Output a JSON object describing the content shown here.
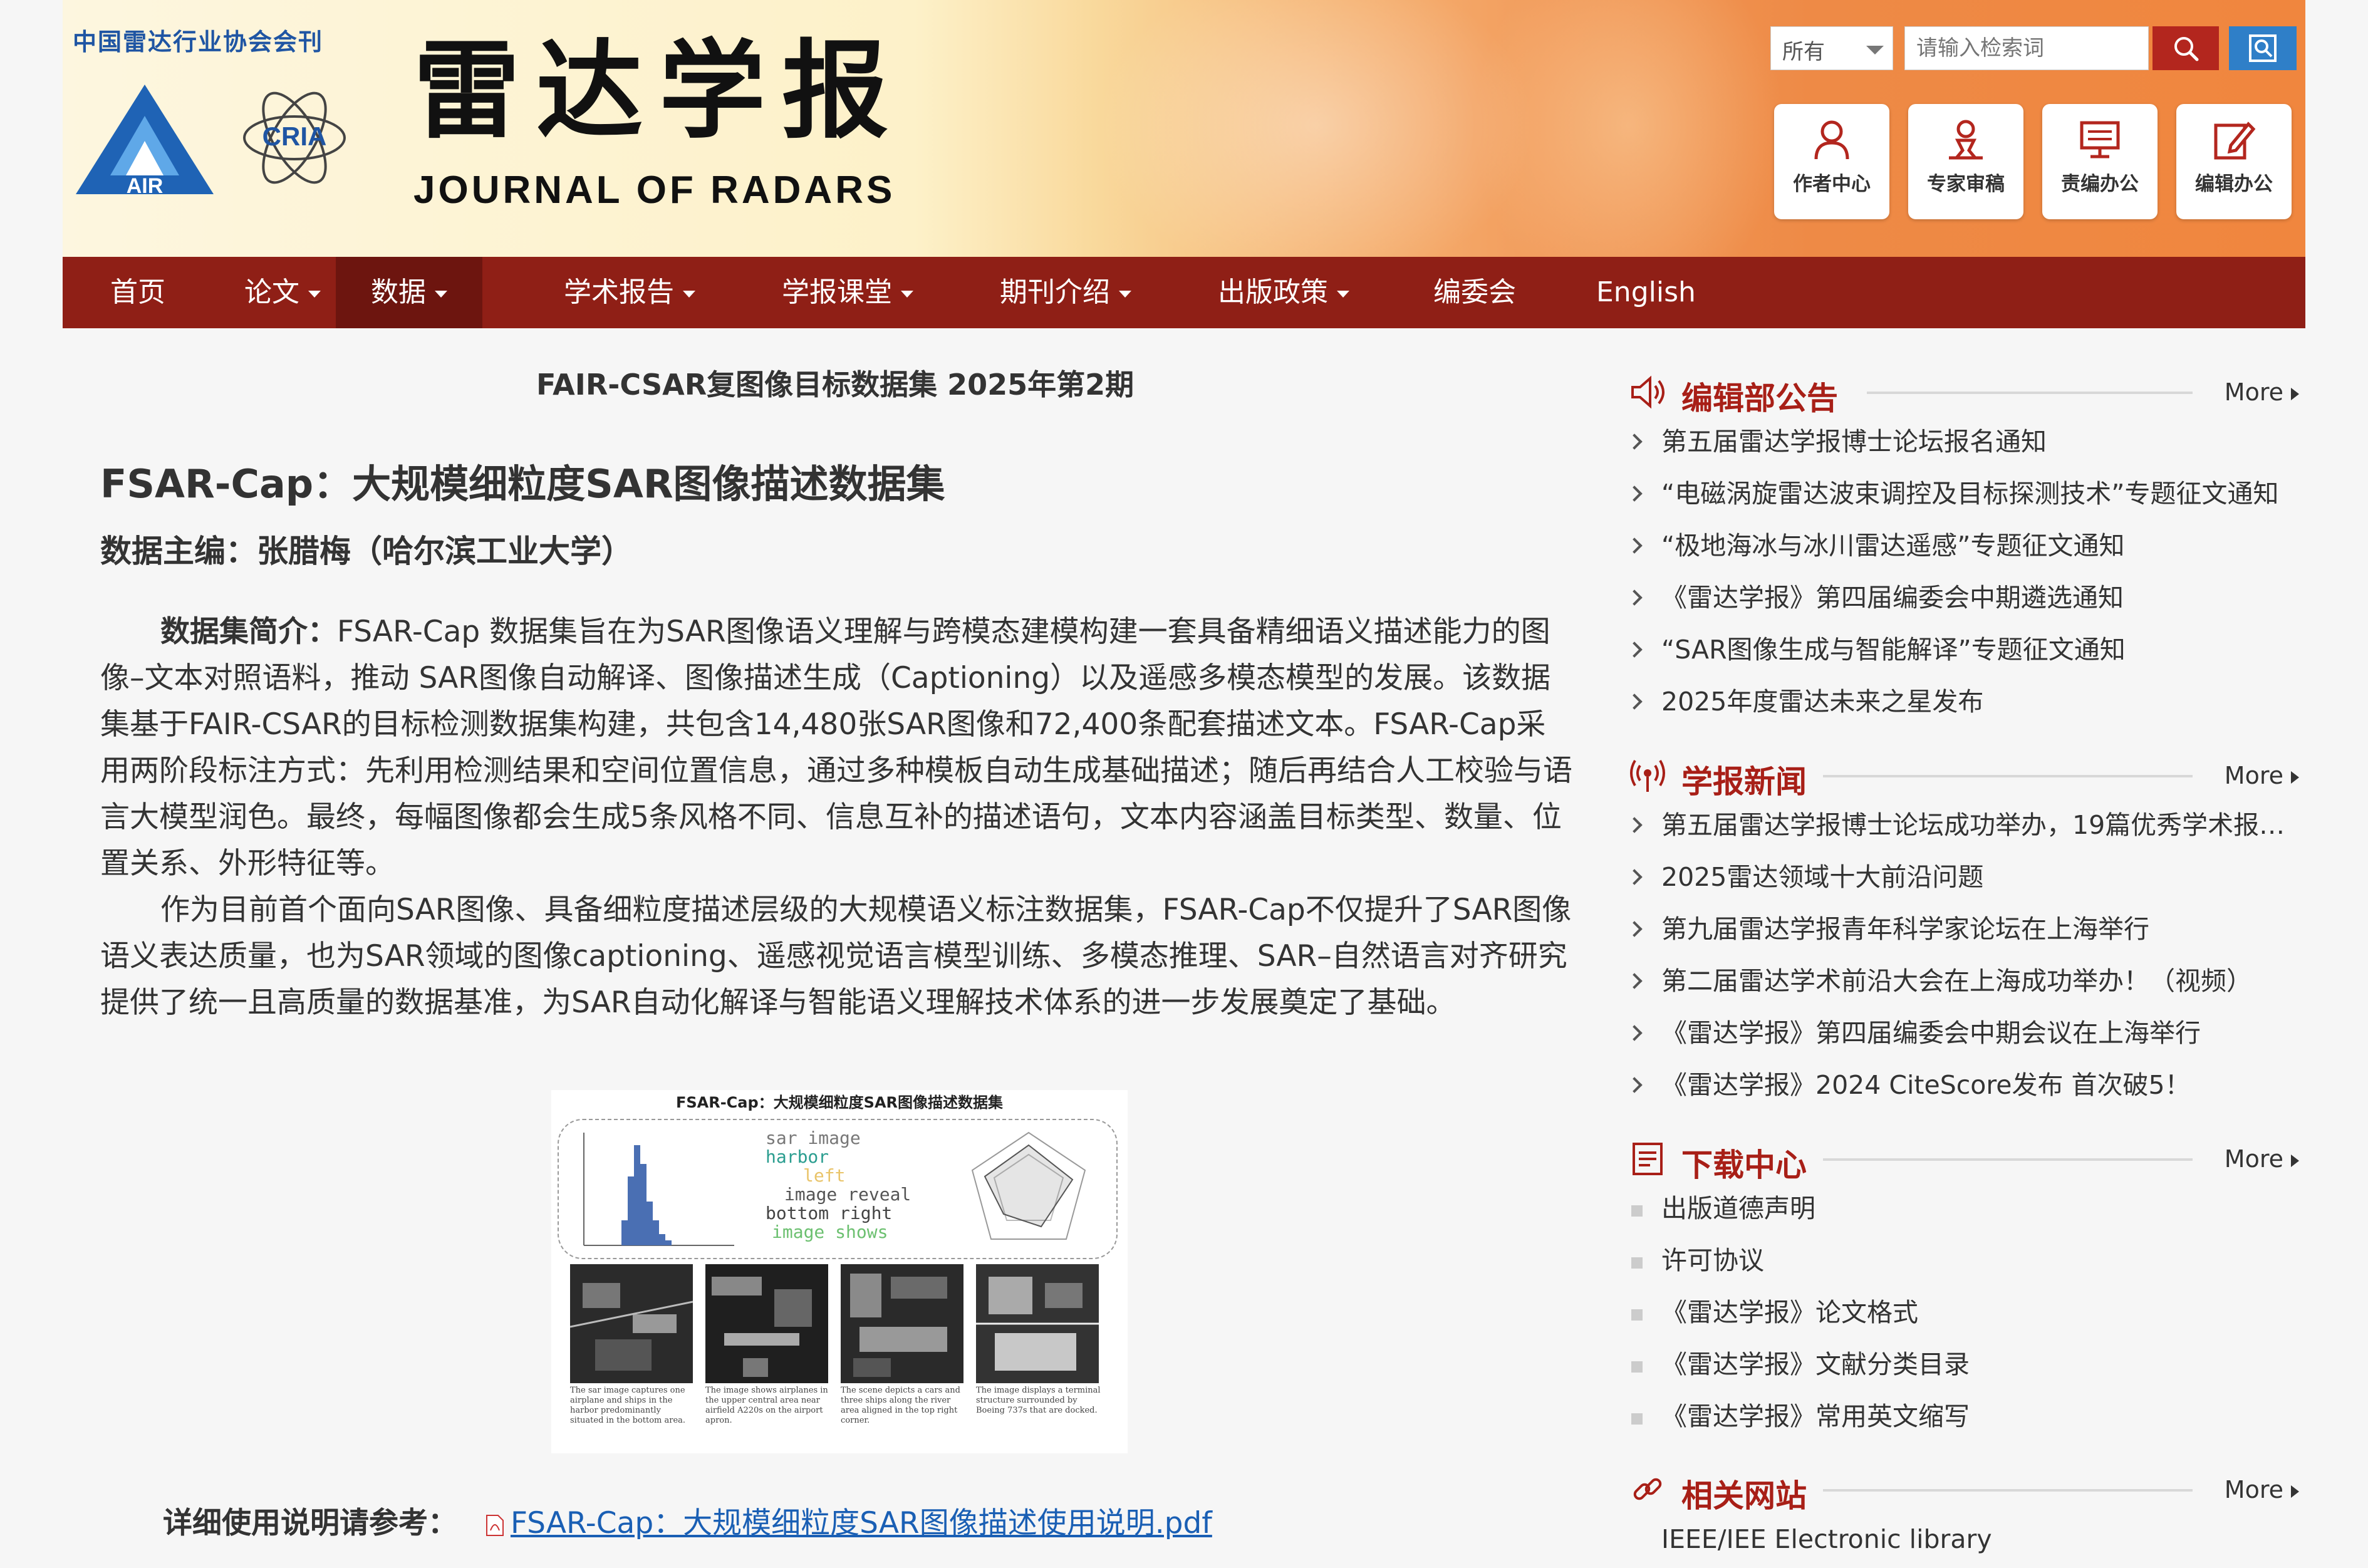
{
  "colors": {
    "brand_red": "#8f1f16",
    "title_red": "#a81f17",
    "link_blue": "#1a5fb4"
  },
  "header": {
    "association": "中国雷达行业协会会刊",
    "logo_air_text": "AIR",
    "logo_cria_text": "CRIA",
    "title_cn": "雷达学报",
    "title_en": "JOURNAL OF RADARS",
    "search": {
      "scope": "所有",
      "placeholder": "请输入检索词"
    },
    "quick_links": [
      {
        "label": "作者中心",
        "icon": "author-icon"
      },
      {
        "label": "专家审稿",
        "icon": "reviewer-icon"
      },
      {
        "label": "责编办公",
        "icon": "monitor-icon"
      },
      {
        "label": "编辑办公",
        "icon": "edit-icon"
      }
    ]
  },
  "nav": {
    "items": [
      {
        "label": "首页"
      },
      {
        "label": "论文"
      },
      {
        "label": "数据"
      },
      {
        "label": "学术报告"
      },
      {
        "label": "学报课堂"
      },
      {
        "label": "期刊介绍"
      },
      {
        "label": "出版政策"
      },
      {
        "label": "编委会"
      },
      {
        "label": "English"
      }
    ],
    "active": "数据"
  },
  "main": {
    "subheading": "FAIR-CSAR复图像目标数据集 2025年第2期",
    "title": "FSAR-Cap：大规模细粒度SAR图像描述数据集",
    "editor": "数据主编：张腊梅（哈尔滨工业大学）",
    "intro_label": "数据集简介：",
    "intro_text": "FSAR-Cap 数据集旨在为SAR图像语义理解与跨模态建模构建一套具备精细语义描述能力的图像–文本对照语料，推动 SAR图像自动解译、图像描述生成（Captioning）以及遥感多模态模型的发展。该数据集基于FAIR-CSAR的目标检测数据集构建，共包含14,480张SAR图像和72,400条配套描述文本。FSAR-Cap采用两阶段标注方式：先利用检测结果和空间位置信息，通过多种模板自动生成基础描述；随后再结合人工校验与语言大模型润色。最终，每幅图像都会生成5条风格不同、信息互补的描述语句，文本内容涵盖目标类型、数量、位置关系、外形特征等。",
    "paragraph2": "作为目前首个面向SAR图像、具备细粒度描述层级的大规模语义标注数据集，FSAR-Cap不仅提升了SAR图像语义表达质量，也为SAR领域的图像captioning、遥感视觉语言模型训练、多模态推理、SAR–自然语言对齐研究提供了统一且高质量的数据基准，为SAR自动化解译与智能语义理解技术体系的进一步发展奠定了基础。",
    "figure": {
      "title": "FSAR-Cap：大规模细粒度SAR图像描述数据集",
      "wordcloud": [
        "sar image",
        "harbor",
        "left",
        "image reveal",
        "bottom right",
        "image shows"
      ],
      "captions": [
        "The sar image captures one airplane and ships in the harbor predominantly situated in the bottom area.",
        "The image shows airplanes in the upper central area near airfield A220s on the airport apron.",
        "The scene depicts a cars and three ships along the river area aligned in the top right corner.",
        "The image displays a terminal structure surrounded by Boeing 737s that are docked."
      ]
    },
    "reference_label": "详细使用说明请参考：",
    "reference_link": "FSAR-Cap：大规模细粒度SAR图像描述使用说明.pdf"
  },
  "sidebar": {
    "more_label": "More",
    "announcements": {
      "title": "编辑部公告",
      "items": [
        "第五届雷达学报博士论坛报名通知",
        "“电磁涡旋雷达波束调控及目标探测技术”专题征文通知",
        "“极地海冰与冰川雷达遥感”专题征文通知",
        "《雷达学报》第四届编委会中期遴选通知",
        "“SAR图像生成与智能解译”专题征文通知",
        "2025年度雷达未来之星发布"
      ]
    },
    "news": {
      "title": "学报新闻",
      "items": [
        "第五届雷达学报博士论坛成功举办，19篇优秀学术报告...",
        "2025雷达领域十大前沿问题",
        "第九届雷达学报青年科学家论坛在上海举行",
        "第二届雷达学术前沿大会在上海成功举办！（视频）",
        "《雷达学报》第四届编委会中期会议在上海举行",
        "《雷达学报》2024 CiteScore发布 首次破5！"
      ]
    },
    "downloads": {
      "title": "下载中心",
      "items": [
        "出版道德声明",
        "许可协议",
        "《雷达学报》论文格式",
        "《雷达学报》文献分类目录",
        "《雷达学报》常用英文缩写"
      ]
    },
    "links": {
      "title": "相关网站",
      "items": [
        "IEEE/IEE Electronic library"
      ]
    }
  }
}
